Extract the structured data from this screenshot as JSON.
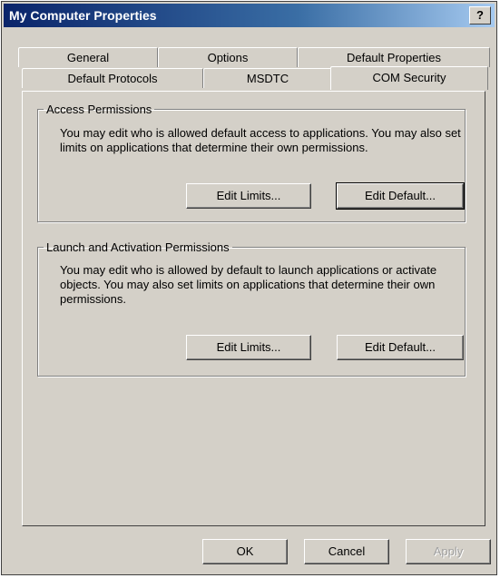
{
  "window": {
    "title": "My Computer Properties",
    "help_button": "?",
    "close_button": "×"
  },
  "tabs": {
    "row1": [
      "General",
      "Options",
      "Default Properties"
    ],
    "row2": [
      "Default Protocols",
      "MSDTC",
      "COM Security"
    ],
    "selected": "COM Security"
  },
  "access": {
    "title": "Access Permissions",
    "description": "You may edit who is allowed default access to applications. You may also set limits on applications that determine their own permissions.",
    "edit_limits": "Edit Limits...",
    "edit_default": "Edit Default..."
  },
  "launch": {
    "title": "Launch and Activation Permissions",
    "description": "You may edit who is allowed by default to launch applications or activate objects. You may also set limits on applications that determine their own permissions.",
    "edit_limits": "Edit Limits...",
    "edit_default": "Edit Default..."
  },
  "footer": {
    "ok": "OK",
    "cancel": "Cancel",
    "apply": "Apply"
  }
}
